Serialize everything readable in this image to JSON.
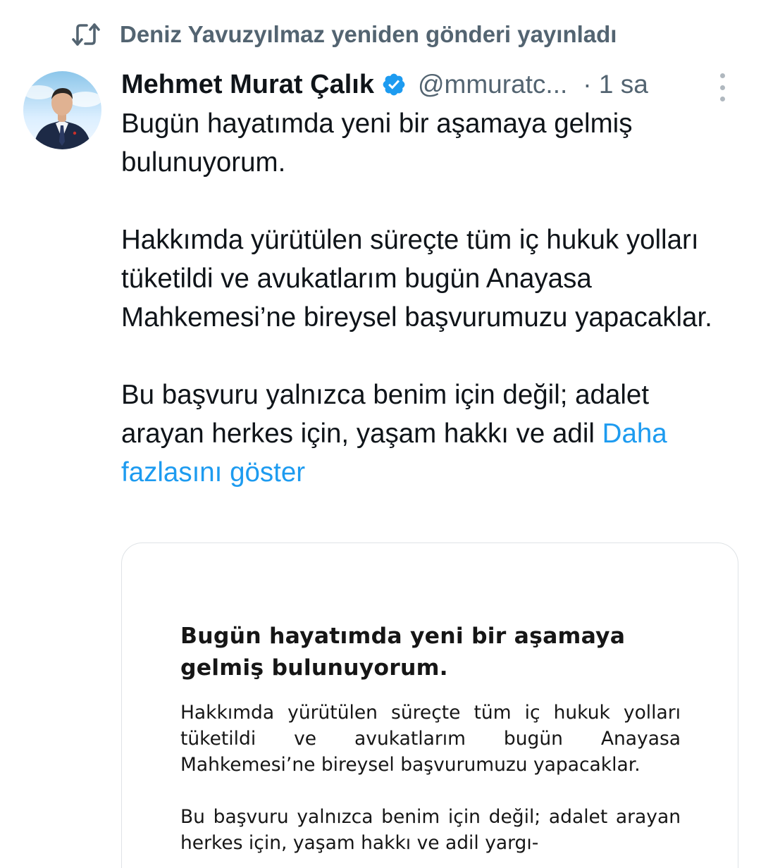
{
  "repost": {
    "icon": "repost-icon",
    "text": "Deniz Yavuzyılmaz yeniden gönderi yayınladı"
  },
  "tweet": {
    "display_name": "Mehmet Murat Çalık",
    "verified_icon": "verified-badge-icon",
    "handle": "@mmuratc...",
    "time": "· 1 sa",
    "more_icon": "more-vertical-icon",
    "text_paragraphs": [
      "Bugün hayatımda yeni bir aşamaya gelmiş bulunuyorum.",
      "Hakkımda yürütülen süreçte tüm iç hukuk yolları tüketildi ve avukatlarım bugün Anayasa Mahkemesi’ne bireysel başvurumuzu yapacaklar."
    ],
    "last_paragraph": "Bu başvuru yalnızca benim için değil; adalet arayan herkes için, yaşam hakkı ve adil",
    "show_more": "Daha fazlasını göster"
  },
  "media": {
    "heading": "Bugün hayatımda yeni bir aşamaya gelmiş bulunuyorum.",
    "paragraph1": "Hakkımda yürütülen süreçte tüm iç hukuk yolları tüketildi ve avukatlarım bugün Anayasa Mahkemesi’ne bireysel başvurumuzu yapacaklar.",
    "paragraph2": "Bu başvuru yalnızca benim için değil; adalet arayan herkes için, yaşam hakkı ve adil yargı-"
  },
  "colors": {
    "accent_link": "#1d9bf0",
    "secondary_text": "#536471",
    "primary_text": "#0f1419",
    "verified": "#1d9bf0"
  }
}
